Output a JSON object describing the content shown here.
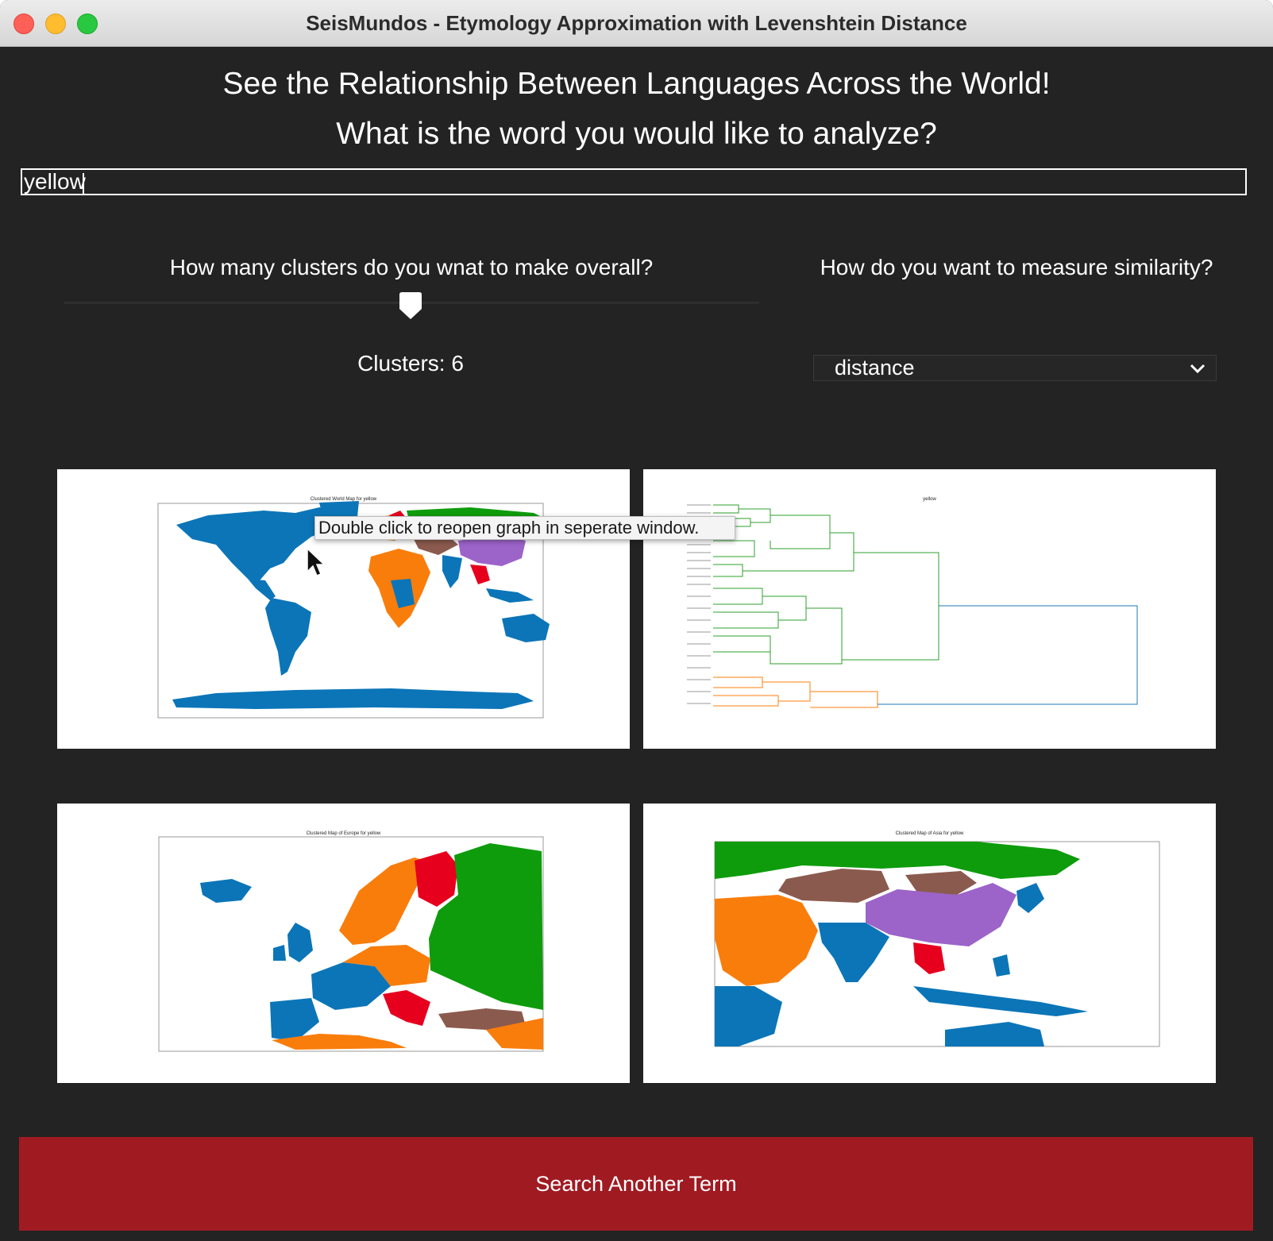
{
  "window": {
    "title": "SeisMundos - Etymology Approximation with Levenshtein Distance"
  },
  "header": {
    "heading": "See the Relationship Between Languages Across the World!",
    "prompt": "What is the word you would like to analyze?"
  },
  "word_input": {
    "value": "yellow"
  },
  "clusters": {
    "label": "How many clusters do you wnat to make overall?",
    "value_text": "Clusters: 6",
    "slider_value": 6
  },
  "similarity": {
    "label": "How do you want to measure similarity?",
    "selected": "distance"
  },
  "graphs": {
    "world_title": "Clustered World Map for yellow",
    "dendrogram_title": "yellow",
    "europe_title": "Clustered Map of Europe for yellow",
    "asia_title": "Clustered Map of Asia for yellow",
    "tooltip": "Double click to reopen graph in seperate window."
  },
  "cluster_colors": [
    "#0b75b8",
    "#f97d0b",
    "#e6001e",
    "#0e9c0c",
    "#8b5a4e",
    "#9c63c9"
  ],
  "icons": {
    "cursor": "arrow-cursor-icon",
    "dropdown": "chevron-down-icon"
  },
  "footer": {
    "button_label": "Search Another Term"
  }
}
